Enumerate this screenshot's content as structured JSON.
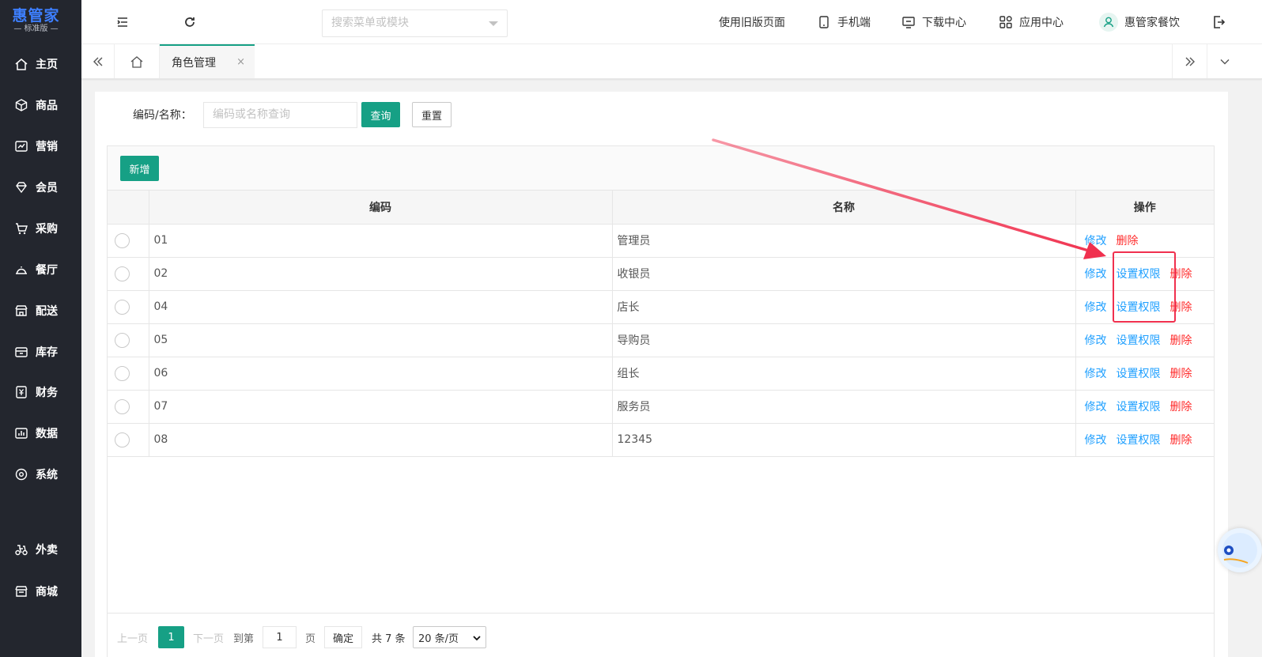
{
  "sidebar": {
    "logo_main": "惠管家",
    "logo_sub": "— 标准版 —",
    "items": [
      {
        "label": "主页",
        "icon": "home-icon"
      },
      {
        "label": "商品",
        "icon": "cube-icon"
      },
      {
        "label": "营销",
        "icon": "chart-icon"
      },
      {
        "label": "会员",
        "icon": "diamond-icon"
      },
      {
        "label": "采购",
        "icon": "cart-icon"
      },
      {
        "label": "餐厅",
        "icon": "cloche-icon"
      },
      {
        "label": "配送",
        "icon": "store-icon"
      },
      {
        "label": "库存",
        "icon": "box-icon"
      },
      {
        "label": "财务",
        "icon": "yen-icon"
      },
      {
        "label": "数据",
        "icon": "bar-chart-icon"
      },
      {
        "label": "系统",
        "icon": "settings-icon"
      },
      {
        "label": "外卖",
        "icon": "scooter-icon"
      },
      {
        "label": "商城",
        "icon": "shop-icon"
      }
    ]
  },
  "topbar": {
    "search_placeholder": "搜索菜单或模块",
    "old_page": "使用旧版页面",
    "mobile": "手机端",
    "download": "下载中心",
    "apps": "应用中心",
    "user": "惠管家餐饮"
  },
  "tabs": {
    "active": "角色管理",
    "close": "×"
  },
  "filter": {
    "label": "编码/名称：",
    "placeholder": "编码或名称查询",
    "query": "查询",
    "reset": "重置"
  },
  "toolbar": {
    "add": "新增"
  },
  "table": {
    "headers": [
      "编码",
      "名称",
      "操作"
    ],
    "rows": [
      {
        "code": "01",
        "name": "管理员",
        "has_perm": false
      },
      {
        "code": "02",
        "name": "收银员",
        "has_perm": true
      },
      {
        "code": "04",
        "name": "店长",
        "has_perm": true
      },
      {
        "code": "05",
        "name": "导购员",
        "has_perm": true
      },
      {
        "code": "06",
        "name": "组长",
        "has_perm": true
      },
      {
        "code": "07",
        "name": "服务员",
        "has_perm": true
      },
      {
        "code": "08",
        "name": "12345",
        "has_perm": true
      }
    ],
    "op_edit": "修改",
    "op_perm": "设置权限",
    "op_delete": "删除"
  },
  "pager": {
    "prev": "上一页",
    "current": "1",
    "next": "下一页",
    "goto": "到第",
    "page_input": "1",
    "page_unit": "页",
    "confirm": "确定",
    "total": "共 7 条",
    "page_size": "20 条/页"
  },
  "colors": {
    "accent": "#16a085",
    "link": "#1e9fff",
    "danger": "#ff2d2d",
    "sidebar": "#23262e",
    "annotation": "#f0304e"
  }
}
